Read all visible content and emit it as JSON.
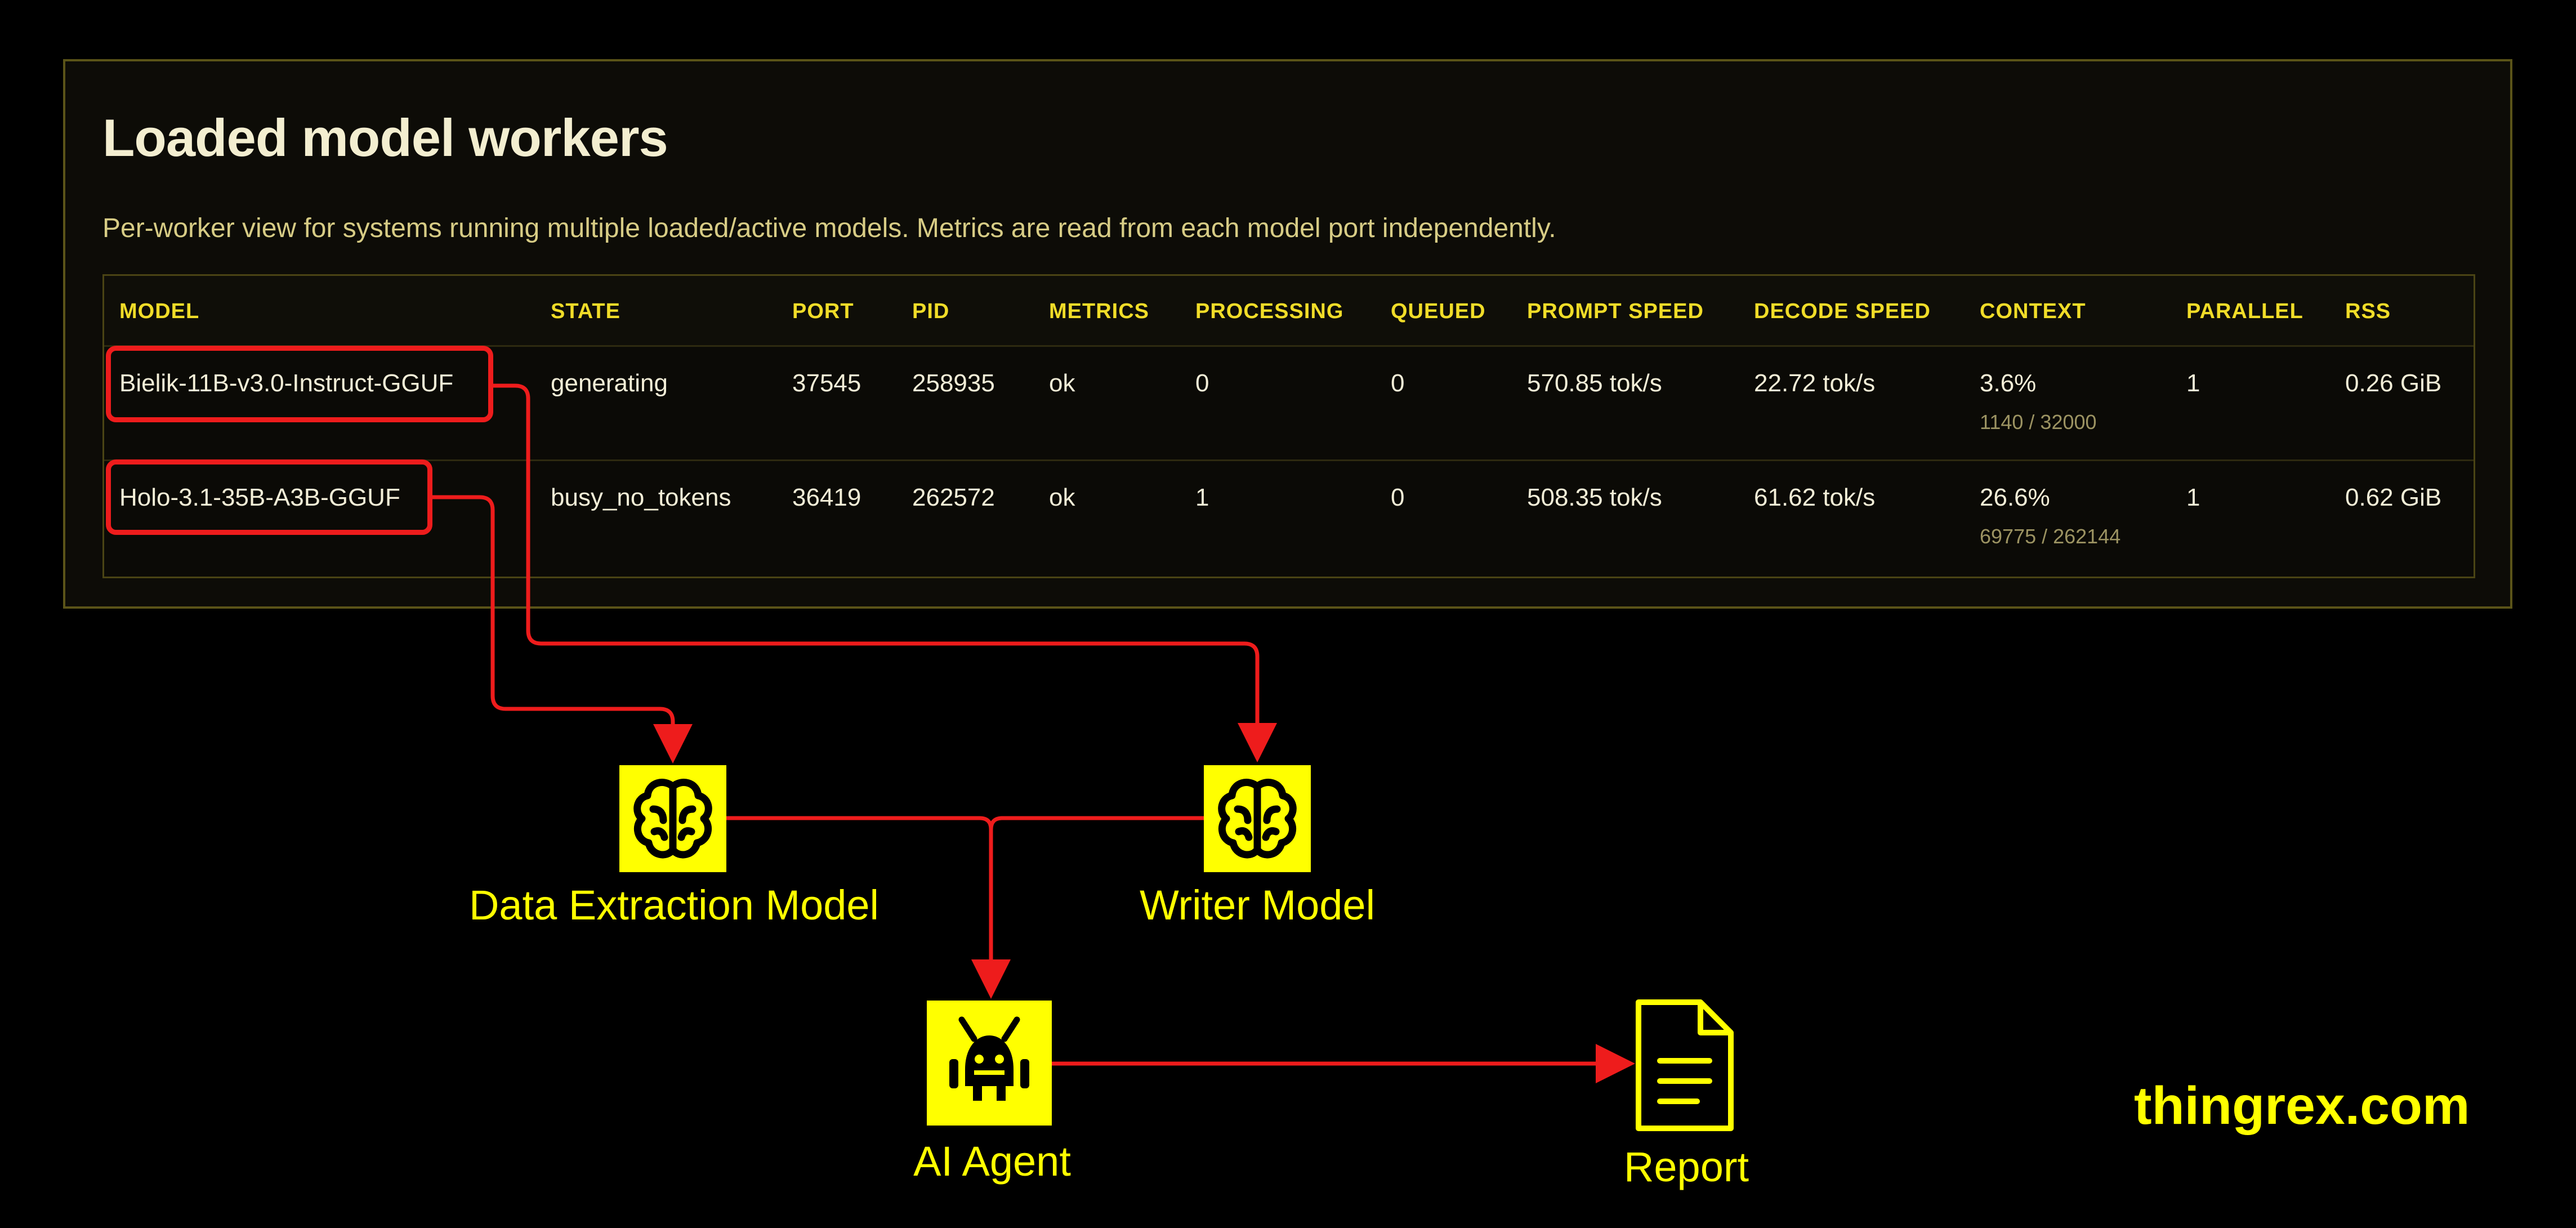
{
  "panel": {
    "title": "Loaded model workers",
    "description": "Per-worker view for systems running multiple loaded/active models. Metrics are read from each model port independently."
  },
  "table": {
    "columns": [
      "MODEL",
      "STATE",
      "PORT",
      "PID",
      "METRICS",
      "PROCESSING",
      "QUEUED",
      "PROMPT SPEED",
      "DECODE SPEED",
      "CONTEXT",
      "PARALLEL",
      "RSS"
    ],
    "rows": [
      {
        "model": "Bielik-11B-v3.0-Instruct-GGUF",
        "state": "generating",
        "port": "37545",
        "pid": "258935",
        "metrics": "ok",
        "processing": "0",
        "queued": "0",
        "prompt_speed": "570.85 tok/s",
        "decode_speed": "22.72 tok/s",
        "context": "3.6%",
        "context_detail": "1140 / 32000",
        "parallel": "1",
        "rss": "0.26 GiB"
      },
      {
        "model": "Holo-3.1-35B-A3B-GGUF",
        "state": "busy_no_tokens",
        "port": "36419",
        "pid": "262572",
        "metrics": "ok",
        "processing": "1",
        "queued": "0",
        "prompt_speed": "508.35 tok/s",
        "decode_speed": "61.62 tok/s",
        "context": "26.6%",
        "context_detail": "69775 / 262144",
        "parallel": "1",
        "rss": "0.62 GiB"
      }
    ]
  },
  "diagram": {
    "nodes": [
      {
        "id": "data-extraction",
        "label": "Data Extraction Model",
        "icon": "brain-icon"
      },
      {
        "id": "writer",
        "label": "Writer Model",
        "icon": "brain-icon"
      },
      {
        "id": "ai-agent",
        "label": "AI Agent",
        "icon": "robot-icon"
      },
      {
        "id": "report",
        "label": "Report",
        "icon": "document-icon"
      }
    ],
    "edges": [
      {
        "from": "Holo-3.1-35B-A3B-GGUF",
        "to": "data-extraction"
      },
      {
        "from": "Bielik-11B-v3.0-Instruct-GGUF",
        "to": "writer"
      },
      {
        "from": "data-extraction",
        "to": "ai-agent"
      },
      {
        "from": "writer",
        "to": "ai-agent"
      },
      {
        "from": "ai-agent",
        "to": "report"
      }
    ]
  },
  "colors": {
    "accent": "#ffff00",
    "highlight": "#ee1c1c",
    "header_text": "#f0dc28",
    "panel_border": "#5b5418"
  },
  "brand": "thingrex.com"
}
